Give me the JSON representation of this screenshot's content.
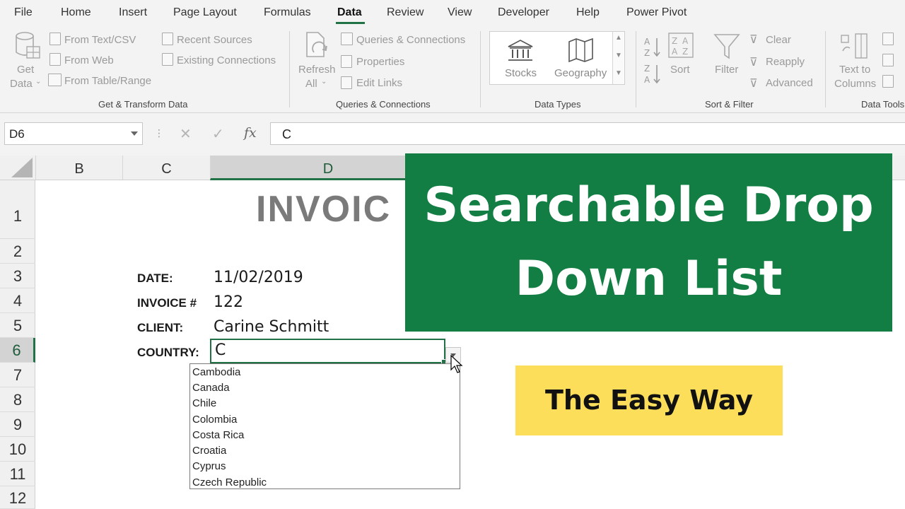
{
  "menu": {
    "tabs": [
      {
        "label": "File"
      },
      {
        "label": "Home"
      },
      {
        "label": "Insert"
      },
      {
        "label": "Page Layout"
      },
      {
        "label": "Formulas"
      },
      {
        "label": "Data"
      },
      {
        "label": "Review"
      },
      {
        "label": "View"
      },
      {
        "label": "Developer"
      },
      {
        "label": "Help"
      },
      {
        "label": "Power Pivot"
      }
    ],
    "active_tab": "Data"
  },
  "ribbon": {
    "get_transform": {
      "get_data_line1": "Get",
      "get_data_line2": "Data",
      "from_text_csv": "From Text/CSV",
      "from_web": "From Web",
      "from_table_range": "From Table/Range",
      "recent_sources": "Recent Sources",
      "existing_connections": "Existing Connections",
      "group_label": "Get & Transform Data"
    },
    "queries": {
      "refresh_line1": "Refresh",
      "refresh_line2": "All",
      "queries_connections": "Queries & Connections",
      "properties": "Properties",
      "edit_links": "Edit Links",
      "group_label": "Queries & Connections"
    },
    "data_types": {
      "stocks": "Stocks",
      "geography": "Geography",
      "group_label": "Data Types"
    },
    "sort_filter": {
      "sort": "Sort",
      "filter": "Filter",
      "clear": "Clear",
      "reapply": "Reapply",
      "advanced": "Advanced",
      "group_label": "Sort & Filter"
    },
    "data_tools": {
      "text_to_columns_line1": "Text to",
      "text_to_columns_line2": "Columns",
      "group_label": "Data Tools"
    }
  },
  "formula_bar": {
    "name_box": "D6",
    "formula": "C",
    "fx_label": "fx"
  },
  "sheet": {
    "columns": [
      {
        "label": "B"
      },
      {
        "label": "C"
      },
      {
        "label": "D"
      }
    ],
    "selected_column": "D",
    "rows": [
      "1",
      "2",
      "3",
      "4",
      "5",
      "6",
      "7",
      "8",
      "9",
      "10",
      "11",
      "12"
    ],
    "selected_row": "6",
    "invoice_heading": "INVOIC",
    "fields": [
      {
        "label": "DATE:",
        "value": "11/02/2019"
      },
      {
        "label": "INVOICE #",
        "value": "122"
      },
      {
        "label": "CLIENT:",
        "value": "Carine Schmitt"
      },
      {
        "label": "COUNTRY:",
        "value": "C"
      }
    ],
    "dropdown_items": [
      "Cambodia",
      "Canada",
      "Chile",
      "Colombia",
      "Costa Rica",
      "Croatia",
      "Cyprus",
      "Czech Republic"
    ]
  },
  "overlay": {
    "title_line1": "Searchable Drop",
    "title_line2": "Down List",
    "subtitle": "The Easy Way",
    "title_bg": "#137e43",
    "subtitle_bg": "#fcde5a"
  },
  "colors": {
    "excel_green": "#217346",
    "ribbon_bg": "#f3f3f3"
  },
  "icons": [
    "database-icon",
    "file-icon",
    "bank-icon",
    "map-icon",
    "sort-az-icon",
    "filter-icon",
    "refresh-icon",
    "mouse-pointer-icon"
  ]
}
